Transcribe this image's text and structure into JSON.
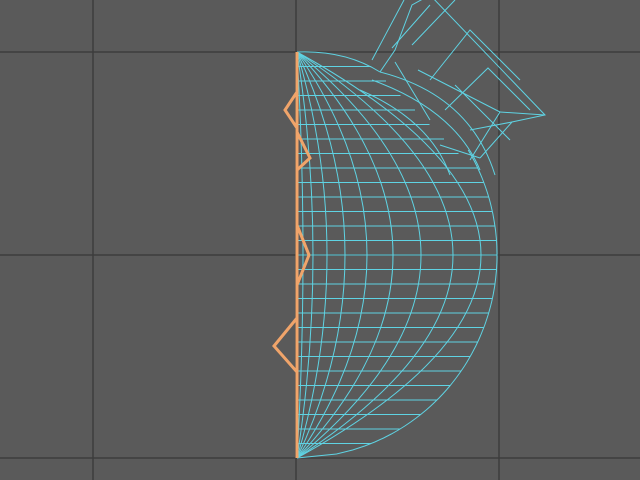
{
  "viewport": {
    "background": "#5a5a5a",
    "grid_color": "#3c3c3c",
    "wire_color": "#5fd3e3",
    "profile_color": "#f0a46a"
  },
  "objects": [
    {
      "name": "revolved-mesh",
      "kind": "wireframe",
      "selected": false
    },
    {
      "name": "profile-curve",
      "kind": "spline",
      "selected": true
    }
  ]
}
